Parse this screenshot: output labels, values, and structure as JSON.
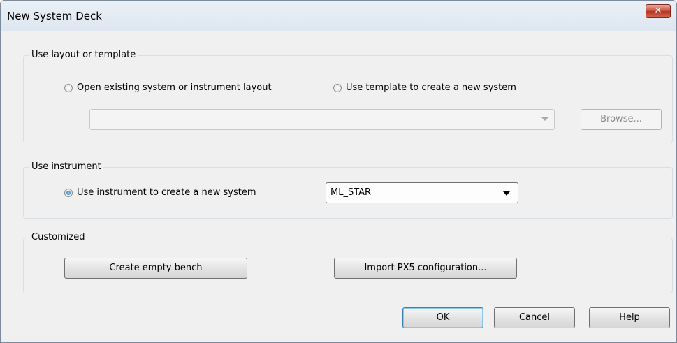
{
  "window": {
    "title": "New System Deck",
    "close_glyph": "✕"
  },
  "layout_group": {
    "label": "Use layout or template",
    "radio_open_label": "Open existing system or instrument layout",
    "radio_template_label": "Use template to create a new system",
    "combo_value": "",
    "browse_label": "Browse..."
  },
  "instrument_group": {
    "label": "Use instrument",
    "radio_label": "Use instrument to create a new system",
    "instrument_value": "ML_STAR"
  },
  "custom_group": {
    "label": "Customized",
    "empty_bench_label": "Create empty bench",
    "import_label": "Import PX5 configuration..."
  },
  "footer": {
    "ok_label": "OK",
    "cancel_label": "Cancel",
    "help_label": "Help"
  }
}
